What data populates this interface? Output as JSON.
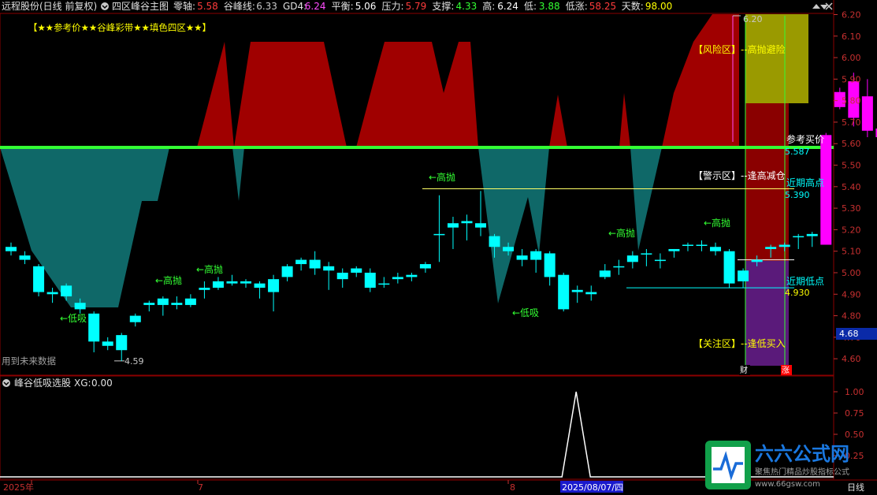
{
  "header": {
    "stock": "远程股份(日线 前复权)",
    "indicator": "四区峰谷主图",
    "items": [
      {
        "label": "零轴:",
        "value": "5.58",
        "color": "#ff3b3b"
      },
      {
        "label": "谷峰线:",
        "value": "6.33",
        "color": "#c8c8c8"
      },
      {
        "label": "GD4:",
        "value": "6.24",
        "color": "#ff4dff"
      },
      {
        "label": "平衡:",
        "value": "5.06",
        "color": "#ffffff"
      },
      {
        "label": "压力:",
        "value": "5.79",
        "color": "#ff3b3b"
      },
      {
        "label": "支撑:",
        "value": "4.33",
        "color": "#33ff33"
      },
      {
        "label": "高:",
        "value": "6.24",
        "color": "#ffffff"
      },
      {
        "label": "低:",
        "value": "3.88",
        "color": "#33ff33"
      },
      {
        "label": "低涨:",
        "value": "58.25",
        "color": "#ff3b3b"
      },
      {
        "label": "天数:",
        "value": "98.00",
        "color": "#ffff00"
      }
    ]
  },
  "main_chart": {
    "banner": "【★★参考价★★谷峰彩带★★填色四区★★】",
    "y_ticks": [
      "6.20",
      "6.10",
      "6.00",
      "5.90",
      "5.80",
      "5.70",
      "5.60",
      "5.50",
      "5.40",
      "5.30",
      "5.20",
      "5.10",
      "5.00",
      "4.90",
      "4.80",
      "4.70",
      "4.60"
    ],
    "current_price": "4.68",
    "future_data_note": "用到未来数据",
    "zone_labels": {
      "risk": "【风险区】--高抛避险",
      "warn": "【警示区】--逢高减仓",
      "focus": "【关注区】--逢低买入"
    },
    "ref_buy": {
      "label": "参考买价",
      "value": "5.587"
    },
    "recent_high": {
      "label": "近期高点",
      "value": "5.390"
    },
    "recent_low": {
      "label": "近期低点",
      "value": "4.930"
    },
    "top_price_label": "6.20",
    "low_price_label": "4.59",
    "markers": {
      "high_sell": "←高抛",
      "low_buy": "←低吸"
    },
    "bottom_tags": {
      "finance": "财",
      "rise": "涨"
    },
    "colors": {
      "bull": "#00ffff",
      "bear": "#00ffff",
      "peak_fill": "#a00000",
      "valley_fill": "#0f6868",
      "zero_line": "#33ff33",
      "magenta": "#ff00ff"
    }
  },
  "chart_data": [
    {
      "type": "candlestick",
      "title": "四区峰谷主图",
      "ylim": [
        4.55,
        6.24
      ],
      "candles": [
        [
          5.12,
          5.1,
          5.14,
          5.08
        ],
        [
          5.08,
          5.06,
          5.1,
          5.04
        ],
        [
          5.03,
          4.91,
          5.04,
          4.89
        ],
        [
          4.91,
          4.9,
          4.93,
          4.86
        ],
        [
          4.94,
          4.89,
          4.95,
          4.87
        ],
        [
          4.86,
          4.83,
          4.88,
          4.81
        ],
        [
          4.81,
          4.68,
          4.82,
          4.63
        ],
        [
          4.68,
          4.66,
          4.7,
          4.64
        ],
        [
          4.71,
          4.64,
          4.72,
          4.59
        ],
        [
          4.77,
          4.8,
          4.81,
          4.75
        ],
        [
          4.85,
          4.86,
          4.87,
          4.82
        ],
        [
          4.85,
          4.88,
          4.89,
          4.8
        ],
        [
          4.86,
          4.85,
          4.89,
          4.83
        ],
        [
          4.85,
          4.88,
          4.9,
          4.84
        ],
        [
          4.92,
          4.93,
          4.96,
          4.88
        ],
        [
          4.93,
          4.96,
          4.98,
          4.92
        ],
        [
          4.96,
          4.95,
          4.99,
          4.94
        ],
        [
          4.95,
          4.96,
          4.97,
          4.93
        ],
        [
          4.95,
          4.93,
          4.96,
          4.88
        ],
        [
          4.97,
          4.91,
          4.99,
          4.82
        ],
        [
          5.03,
          4.98,
          5.04,
          4.96
        ],
        [
          5.04,
          5.06,
          5.07,
          5.01
        ],
        [
          5.02,
          5.06,
          5.1,
          4.99
        ],
        [
          5.03,
          5.01,
          5.05,
          4.92
        ],
        [
          5.0,
          4.97,
          5.02,
          4.93
        ],
        [
          5.0,
          5.02,
          5.03,
          4.98
        ],
        [
          5.0,
          4.93,
          5.02,
          4.91
        ],
        [
          4.95,
          4.95,
          4.98,
          4.93
        ],
        [
          4.97,
          4.98,
          5.0,
          4.95
        ],
        [
          4.99,
          4.98,
          5.0,
          4.96
        ],
        [
          5.02,
          5.04,
          5.05,
          5.0
        ],
        [
          5.18,
          5.18,
          5.36,
          5.05
        ],
        [
          5.21,
          5.23,
          5.26,
          5.11
        ],
        [
          5.23,
          5.24,
          5.27,
          5.15
        ],
        [
          5.23,
          5.21,
          5.38,
          5.17
        ],
        [
          5.17,
          5.12,
          5.18,
          5.07
        ],
        [
          5.12,
          5.1,
          5.14,
          5.08
        ],
        [
          5.08,
          5.06,
          5.11,
          5.03
        ],
        [
          5.06,
          5.1,
          5.11,
          5.0
        ],
        [
          5.09,
          4.98,
          5.1,
          4.94
        ],
        [
          4.99,
          4.83,
          5.0,
          4.82
        ],
        [
          4.92,
          4.91,
          4.94,
          4.86
        ],
        [
          4.9,
          4.91,
          4.94,
          4.87
        ],
        [
          4.98,
          5.01,
          5.04,
          4.97
        ],
        [
          5.03,
          5.03,
          5.06,
          4.99
        ],
        [
          5.05,
          5.08,
          5.1,
          5.02
        ],
        [
          5.09,
          5.09,
          5.11,
          5.03
        ],
        [
          5.06,
          5.06,
          5.09,
          5.02
        ],
        [
          5.1,
          5.11,
          5.11,
          5.07
        ],
        [
          5.13,
          5.13,
          5.14,
          5.1
        ],
        [
          5.13,
          5.13,
          5.15,
          5.1
        ],
        [
          5.1,
          5.12,
          5.14,
          5.08
        ],
        [
          5.1,
          4.95,
          5.11,
          4.93
        ],
        [
          5.01,
          4.96,
          5.02,
          4.93
        ],
        [
          5.05,
          5.06,
          5.08,
          5.03
        ],
        [
          5.12,
          5.11,
          5.13,
          5.07
        ],
        [
          5.13,
          5.12,
          5.14,
          5.1
        ],
        [
          5.17,
          5.17,
          5.18,
          5.11
        ],
        [
          5.18,
          5.17,
          5.19,
          5.12
        ],
        [
          5.64,
          5.13,
          5.65,
          5.13
        ],
        [
          5.77,
          5.84,
          5.86,
          5.76
        ],
        [
          5.72,
          5.89,
          5.93,
          5.68
        ],
        [
          5.82,
          5.66,
          5.9,
          5.63
        ],
        [
          5.63,
          5.67,
          5.75,
          5.6
        ],
        [
          6.14,
          5.66,
          6.17,
          5.65
        ]
      ],
      "indicator_series": {
        "name": "峰谷低吸选股 XG",
        "value": "0.00",
        "ylim": [
          -0.02,
          1.08
        ],
        "y_ticks": [
          "1.00",
          "0.75",
          "0.50",
          "0.25"
        ],
        "signal_bar_index": 40
      }
    }
  ],
  "sub_chart": {
    "title": "峰谷低吸选股",
    "xg_label": "XG:",
    "xg_value": "0.00"
  },
  "x_axis": {
    "labels": [
      "2025年",
      "7",
      "8",
      "2025/08/07/四",
      "日线"
    ]
  },
  "watermark": {
    "title": "六六公式网",
    "subtitle": "聚焦热门精品炒股指标公式",
    "url": "www.66gsw.com"
  },
  "window_controls": [
    "up-arrow",
    "down-arrow",
    "close-x"
  ]
}
